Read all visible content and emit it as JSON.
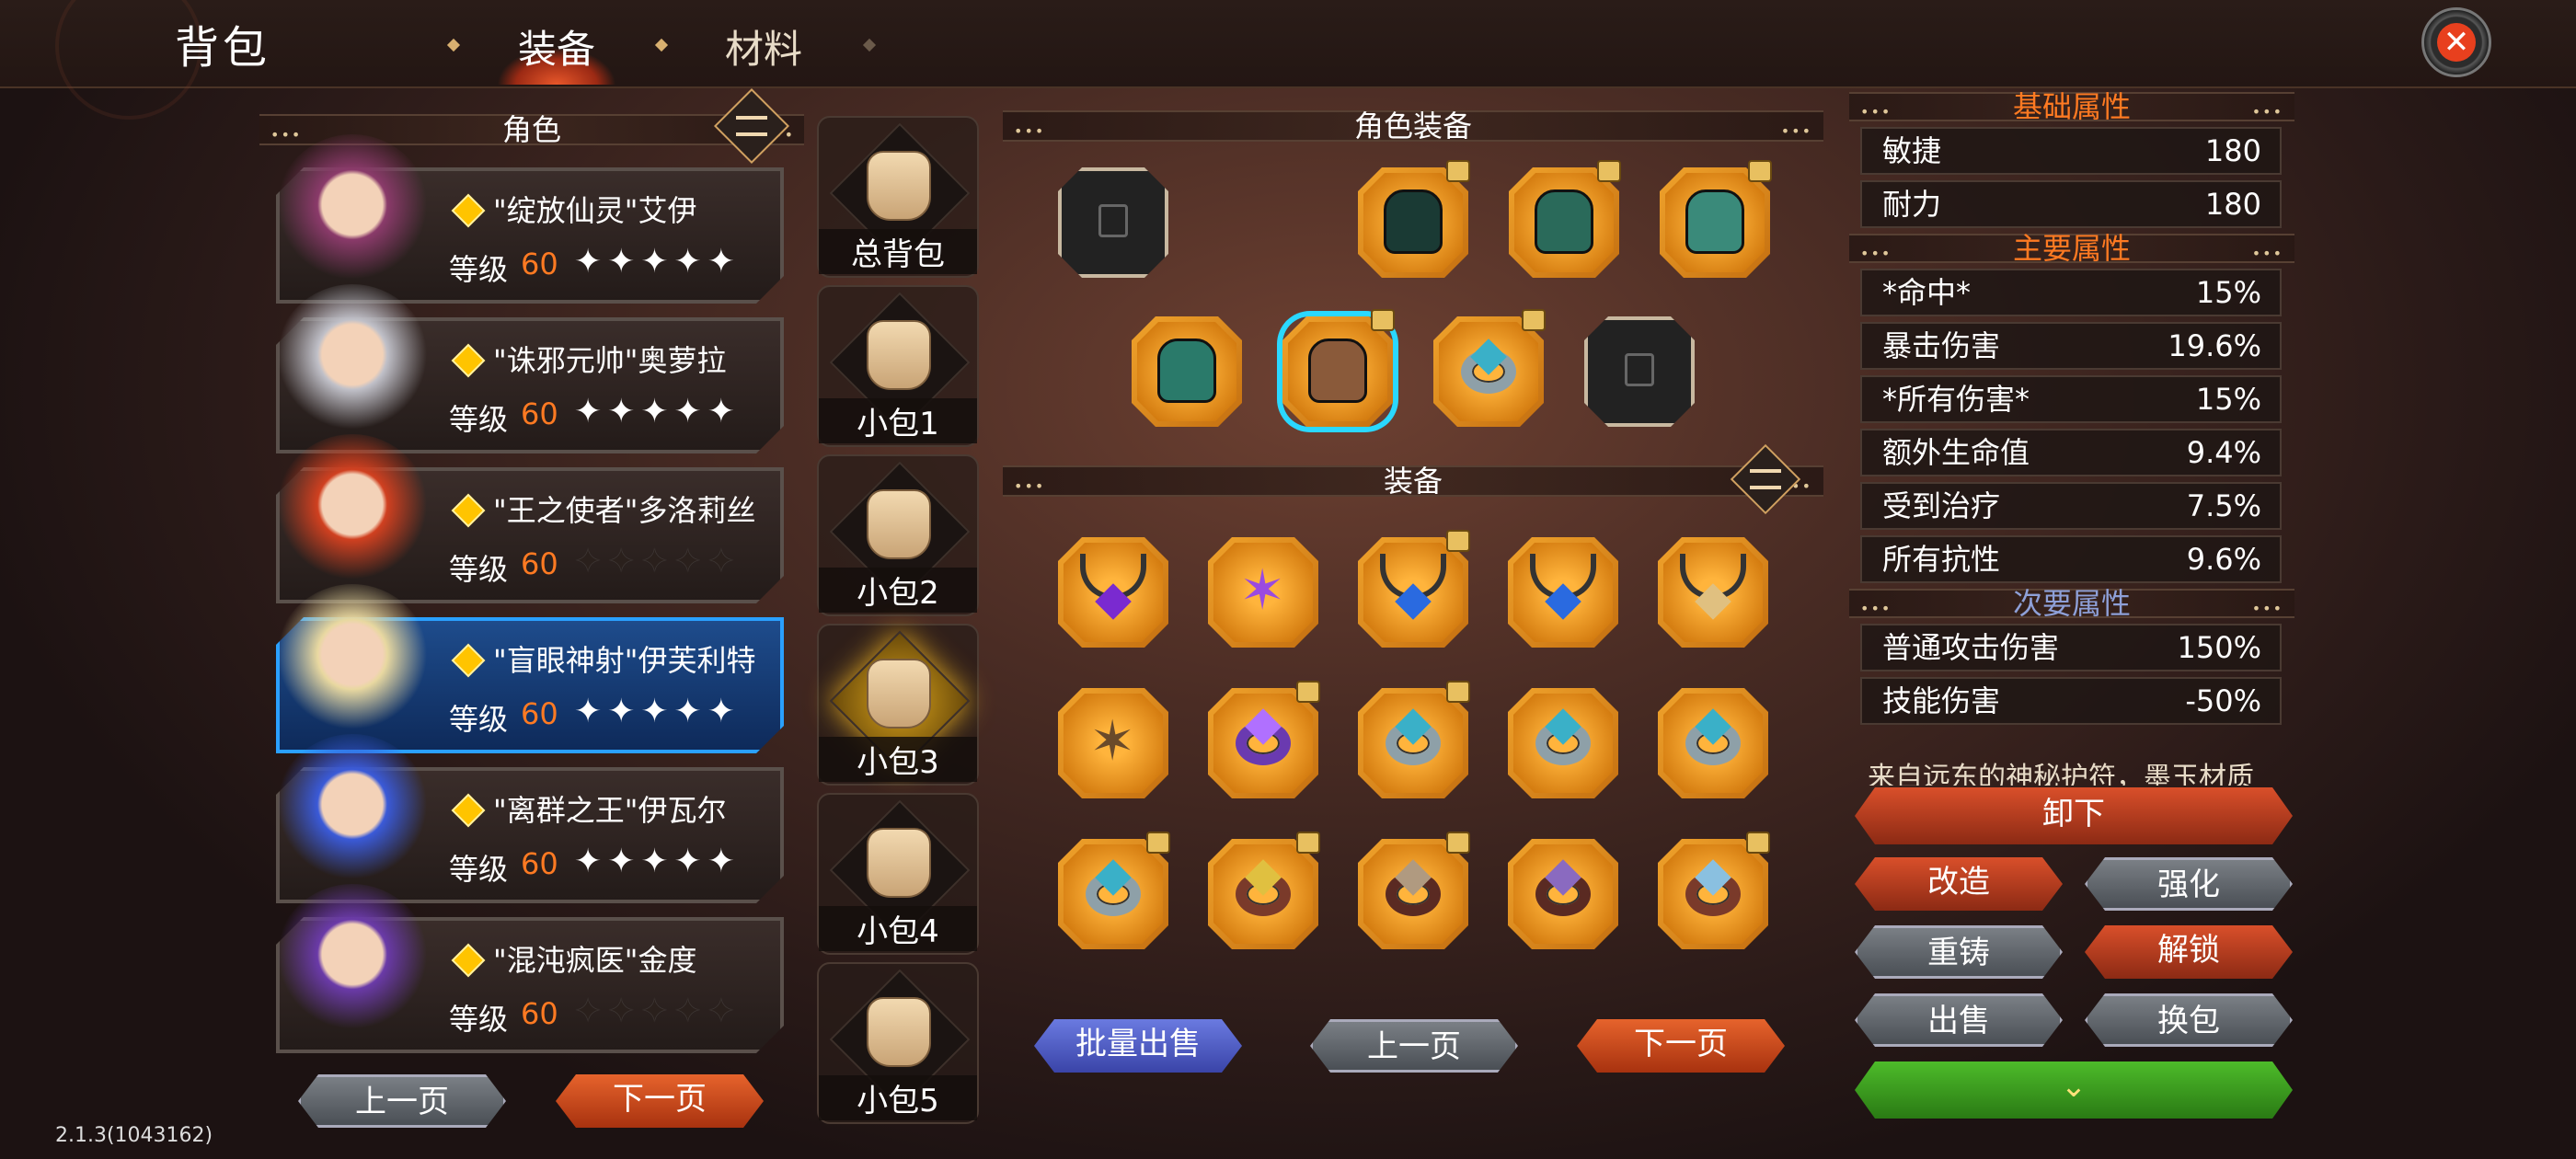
{
  "header": {
    "title": "背包",
    "tabs": [
      {
        "label": "装备",
        "active": true
      },
      {
        "label": "材料",
        "active": false
      }
    ]
  },
  "characters_panel": {
    "title": "角色",
    "level_label": "等级",
    "items": [
      {
        "name": "\"绽放仙灵\"艾伊",
        "level": "60",
        "stars": 5,
        "selected": false
      },
      {
        "name": "\"诛邪元帅\"奥萝拉",
        "level": "60",
        "stars": 5,
        "selected": false
      },
      {
        "name": "\"王之使者\"多洛莉丝",
        "level": "60",
        "stars": 0,
        "selected": false
      },
      {
        "name": "\"盲眼神射\"伊芙利特",
        "level": "60",
        "stars": 5,
        "selected": true
      },
      {
        "name": "\"离群之王\"伊瓦尔",
        "level": "60",
        "stars": 5,
        "selected": false
      },
      {
        "name": "\"混沌疯医\"金度",
        "level": "60",
        "stars": 0,
        "selected": false
      }
    ],
    "prev_label": "上一页",
    "next_label": "下一页"
  },
  "bags": {
    "items": [
      {
        "label": "总背包",
        "selected": false
      },
      {
        "label": "小包1",
        "selected": false
      },
      {
        "label": "小包2",
        "selected": false
      },
      {
        "label": "小包3",
        "selected": true
      },
      {
        "label": "小包4",
        "selected": false
      },
      {
        "label": "小包5",
        "selected": false
      }
    ]
  },
  "character_equipment": {
    "title": "角色装备"
  },
  "equipment": {
    "title": "装备",
    "bulk_sell_label": "批量出售",
    "prev_label": "上一页",
    "next_label": "下一页"
  },
  "stats": {
    "basic_title": "基础属性",
    "basic": [
      {
        "k": "敏捷",
        "v": "180"
      },
      {
        "k": "耐力",
        "v": "180"
      }
    ],
    "main_title": "主要属性",
    "main": [
      {
        "k": "*命中*",
        "v": "15%"
      },
      {
        "k": "暴击伤害",
        "v": "19.6%"
      },
      {
        "k": "*所有伤害*",
        "v": "15%"
      },
      {
        "k": "额外生命值",
        "v": "9.4%"
      },
      {
        "k": "受到治疗",
        "v": "7.5%"
      },
      {
        "k": "所有抗性",
        "v": "9.6%"
      }
    ],
    "secondary_title": "次要属性",
    "secondary": [
      {
        "k": "普通攻击伤害",
        "v": "150%"
      },
      {
        "k": "技能伤害",
        "v": "-50%"
      }
    ],
    "description": "来自远东的神秘护符，墨玉材质"
  },
  "actions": {
    "unequip": "卸下",
    "modify": "改造",
    "enhance": "强化",
    "reforge": "重铸",
    "unlock": "解锁",
    "sell": "出售",
    "swap_bag": "换包"
  },
  "version": "2.1.3(1043162)",
  "colors": {
    "accent": "#ff7a22",
    "selected_border": "#2aa0ff",
    "item_orange": "#f0a32c"
  }
}
